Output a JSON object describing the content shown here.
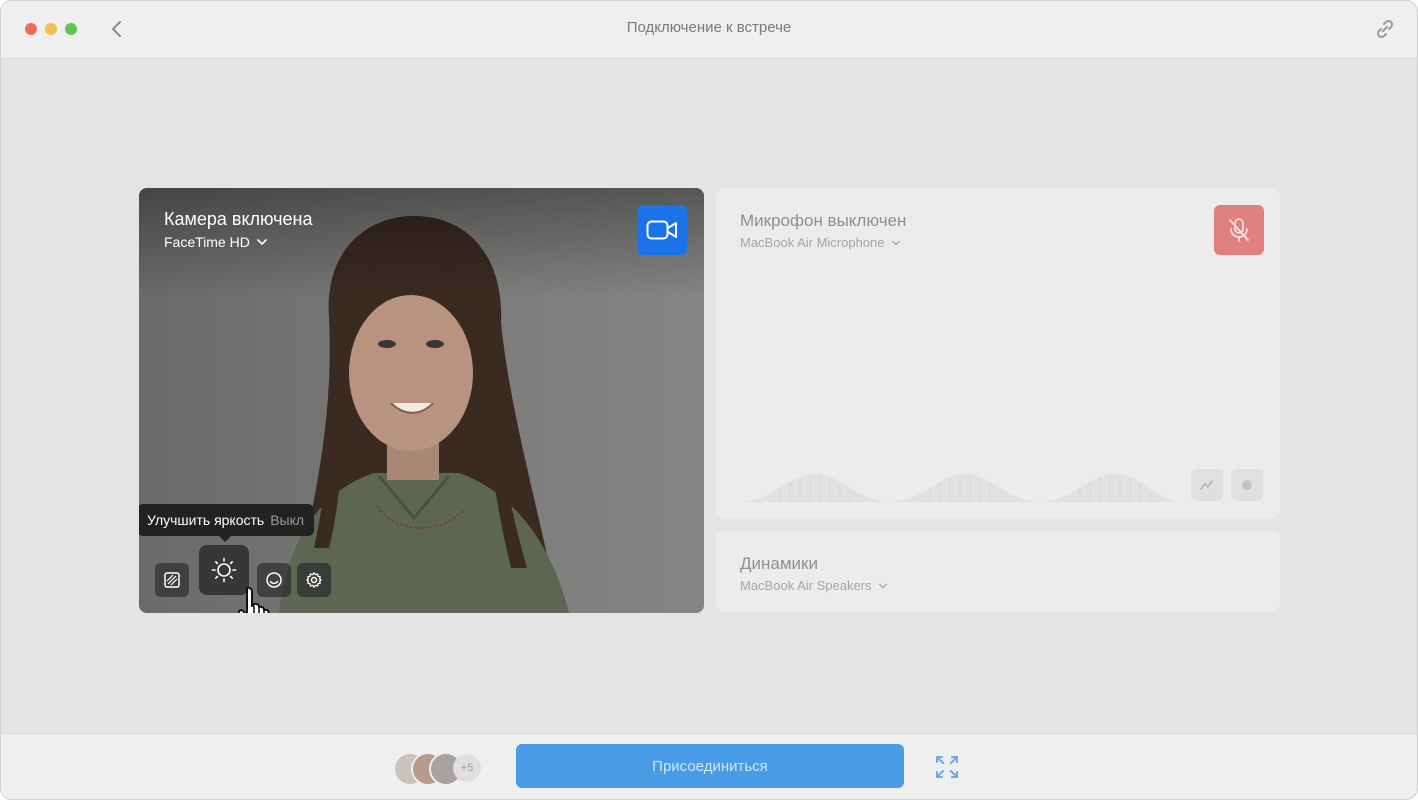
{
  "window": {
    "title": "Подключение к встрече"
  },
  "camera": {
    "title": "Камера включена",
    "device": "FaceTime HD",
    "tooltip": {
      "label": "Улучшить яркость",
      "state": "Выкл"
    },
    "toggle_color": "#1a73e8"
  },
  "microphone": {
    "title": "Микрофон выключен",
    "device": "MacBook Air Microphone",
    "toggle_color": "#e08080"
  },
  "speakers": {
    "title": "Динамики",
    "device": "MacBook Air Speakers"
  },
  "bottom": {
    "participants_extra": "+5",
    "join_label": "Присоединиться"
  },
  "icons": {
    "back": "chevron-left-icon",
    "link": "link-icon",
    "camera": "video-camera-icon",
    "mic_off": "mic-off-icon",
    "background": "background-blur-icon",
    "brightness": "sun-icon",
    "face": "smile-icon",
    "settings": "gear-icon",
    "fit": "expand-icon"
  }
}
